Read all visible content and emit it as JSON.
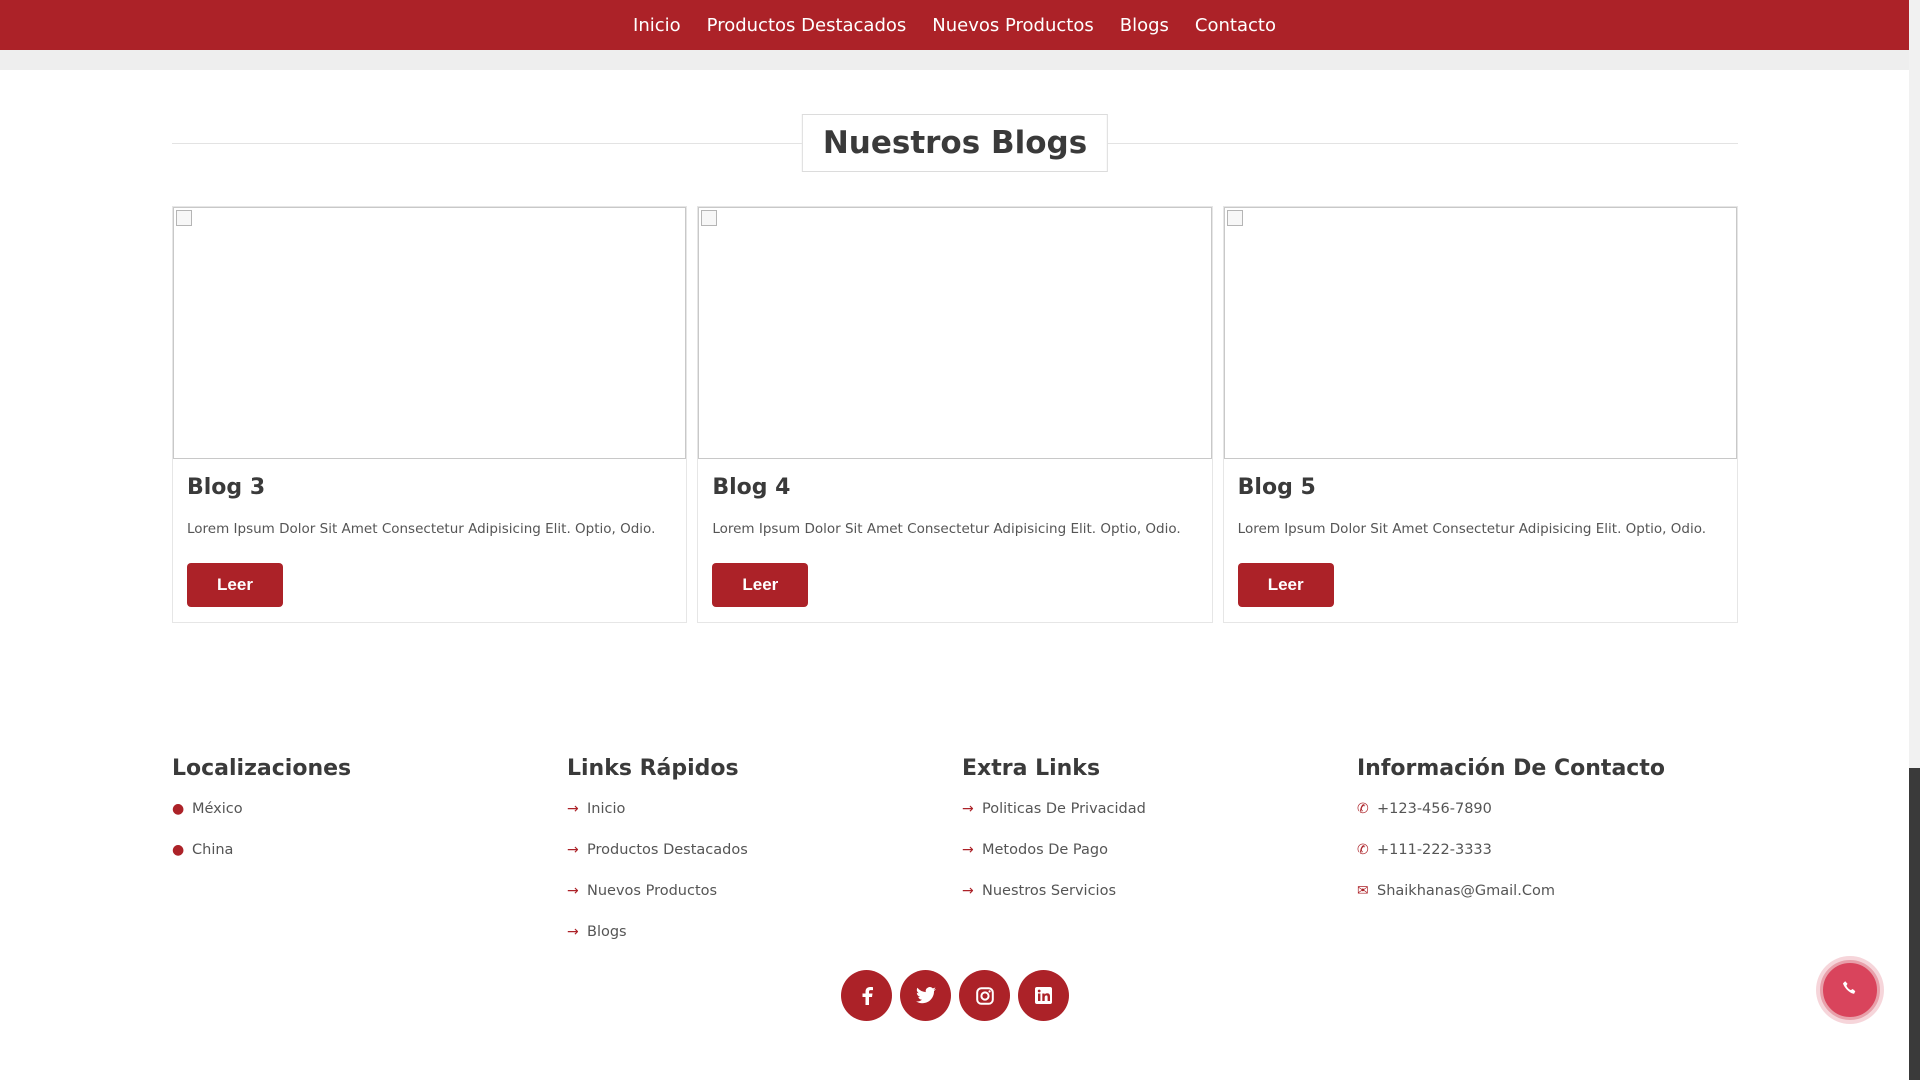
{
  "nav": {
    "items": [
      "Inicio",
      "Productos Destacados",
      "Nuevos Productos",
      "Blogs",
      "Contacto"
    ]
  },
  "section": {
    "title": "Nuestros Blogs"
  },
  "blogs": [
    {
      "title": "Blog 3",
      "text": "Lorem Ipsum Dolor Sit Amet Consectetur Adipisicing Elit. Optio, Odio.",
      "button": "Leer"
    },
    {
      "title": "Blog 4",
      "text": "Lorem Ipsum Dolor Sit Amet Consectetur Adipisicing Elit. Optio, Odio.",
      "button": "Leer"
    },
    {
      "title": "Blog 5",
      "text": "Lorem Ipsum Dolor Sit Amet Consectetur Adipisicing Elit. Optio, Odio.",
      "button": "Leer"
    }
  ],
  "footer": {
    "locations": {
      "title": "Localizaciones",
      "items": [
        "México",
        "China"
      ]
    },
    "quick_links": {
      "title": "Links Rápidos",
      "items": [
        "Inicio",
        "Productos Destacados",
        "Nuevos Productos",
        "Blogs"
      ]
    },
    "extra_links": {
      "title": "Extra Links",
      "items": [
        "Politicas De Privacidad",
        "Metodos De Pago",
        "Nuestros Servicios"
      ]
    },
    "contact": {
      "title": "Información De Contacto",
      "items": [
        "+123-456-7890",
        "+111-222-3333",
        "Shaikhanas@Gmail.Com"
      ]
    }
  },
  "social": [
    "facebook-icon",
    "twitter-icon",
    "instagram-icon",
    "linkedin-icon"
  ],
  "colors": {
    "brand": "#ac2228",
    "fab": "#d9445c"
  }
}
